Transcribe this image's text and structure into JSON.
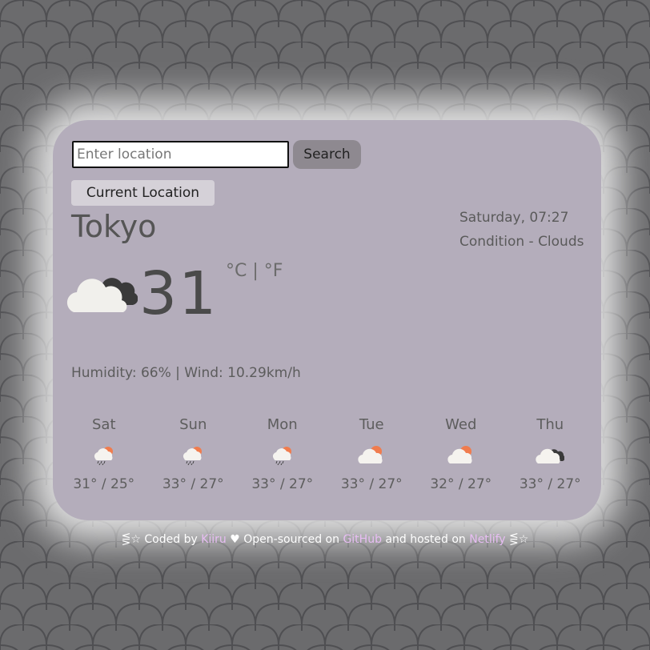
{
  "search": {
    "placeholder": "Enter location",
    "value": "",
    "button_label": "Search"
  },
  "current_location_label": "Current Location",
  "weather": {
    "city": "Tokyo",
    "temperature": "31",
    "unit_celsius": "°C",
    "unit_separator": "|",
    "unit_fahrenheit": "°F",
    "icon": "cloud-icon",
    "datetime": "Saturday, 07:27",
    "condition": "Condition - Clouds",
    "humidity_wind": "Humidity: 66% | Wind: 10.29km/h"
  },
  "forecast": [
    {
      "day": "Sat",
      "temps": "31° / 25°",
      "icon": "rain-sun-icon"
    },
    {
      "day": "Sun",
      "temps": "33° / 27°",
      "icon": "rain-sun-icon"
    },
    {
      "day": "Mon",
      "temps": "33° / 27°",
      "icon": "rain-sun-icon"
    },
    {
      "day": "Tue",
      "temps": "33° / 27°",
      "icon": "cloud-sun-icon"
    },
    {
      "day": "Wed",
      "temps": "32° / 27°",
      "icon": "cloud-sun-icon"
    },
    {
      "day": "Thu",
      "temps": "33° / 27°",
      "icon": "cloud-icon"
    }
  ],
  "footer": {
    "prefix": "⋚☆ Coded by",
    "author": "Kiiru",
    "middle": "Open-sourced on",
    "github": "GitHub",
    "hosted": "and hosted on",
    "netlify": "Netlify",
    "suffix": "⋚☆"
  },
  "colors": {
    "background": "#6b6b6d",
    "card": "#b4adbb",
    "link": "#e7bdf3",
    "sun": "#f07c4e"
  }
}
